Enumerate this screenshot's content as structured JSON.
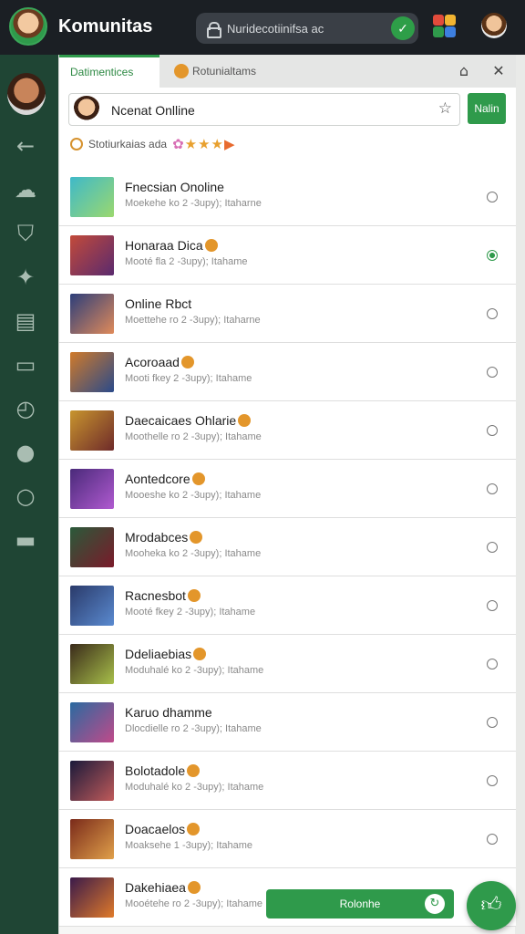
{
  "app": {
    "title": "Komunitas"
  },
  "search": {
    "text": "Nuridecotiinifsa ac"
  },
  "tabs": [
    {
      "label": "Datimentices"
    },
    {
      "label": "Rotunialtams"
    }
  ],
  "input": {
    "value": "Ncenat Onlline"
  },
  "save_label": "Nalin",
  "rating_label": "Stotiurkaias ada",
  "footer_button": "Rolonhe",
  "items": [
    {
      "title": "Fnecsian Onoline",
      "subtitle": "Moekehe ko 2 -3upy); Itaharne",
      "badge": false,
      "selected": false
    },
    {
      "title": "Honaraa Dica",
      "subtitle": "Mooté fla 2 -3upy); Itahame",
      "badge": true,
      "selected": true
    },
    {
      "title": "Online Rbct",
      "subtitle": "Moettehe ro 2 -3upy); Itaharne",
      "badge": false,
      "selected": false
    },
    {
      "title": "Acoroaad",
      "subtitle": "Mooti fkey 2 -3upy); Itahame",
      "badge": true,
      "selected": false
    },
    {
      "title": "Daecaicaes Ohlarie",
      "subtitle": "Moothelle ro 2 -3upy); Itahame",
      "badge": true,
      "selected": false
    },
    {
      "title": "Aontedcore",
      "subtitle": "Mooeshe ko 2 -3upy); Itahame",
      "badge": true,
      "selected": false
    },
    {
      "title": "Mrodabces",
      "subtitle": "Mooheka ko 2 -3upy); Itahame",
      "badge": true,
      "selected": false
    },
    {
      "title": "Racnesbot",
      "subtitle": "Mooté fkey 2 -3upy); Itahame",
      "badge": true,
      "selected": false
    },
    {
      "title": "Ddeliaebias",
      "subtitle": "Moduhalé ko 2 -3upy); Itahame",
      "badge": true,
      "selected": false
    },
    {
      "title": "Karuo dhamme",
      "subtitle": "Dlocdielle ro 2 -3upy); Itahame",
      "badge": false,
      "selected": false
    },
    {
      "title": "Bolotadole",
      "subtitle": "Moduhalé ko 2 -3upy); Itahame",
      "badge": true,
      "selected": false
    },
    {
      "title": "Doacaelos",
      "subtitle": "Moaksehe 1 -3upy); Itahame",
      "badge": true,
      "selected": false
    },
    {
      "title": "Dakehiaea",
      "subtitle": "Mooétehe ro 2 -3upy); Itahame",
      "badge": true,
      "selected": false
    }
  ],
  "colors": {
    "accent": "#2f9a4b",
    "sidebar": "#1f4534",
    "topbar": "#1b1f24",
    "badge": "#e3962b"
  }
}
